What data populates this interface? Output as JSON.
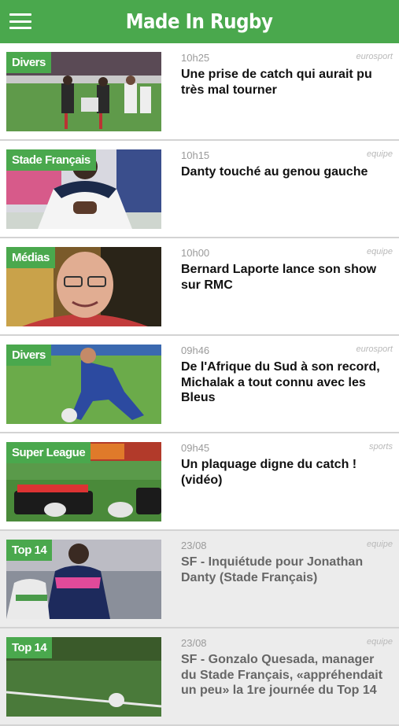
{
  "app": {
    "title": "Made In Rugby"
  },
  "articles": [
    {
      "category": "Divers",
      "time": "10h25",
      "source": "eurosport",
      "title": "Une prise de catch qui aurait pu très mal tourner"
    },
    {
      "category": "Stade Français",
      "time": "10h15",
      "source": "equipe",
      "title": "Danty touché au genou gauche"
    },
    {
      "category": "Médias",
      "time": "10h00",
      "source": "equipe",
      "title": "Bernard Laporte lance son show sur RMC"
    },
    {
      "category": "Divers",
      "time": "09h46",
      "source": "eurosport",
      "title": "De l'Afrique du Sud à son record, Michalak a tout connu avec les Bleus"
    },
    {
      "category": "Super League",
      "time": "09h45",
      "source": "sports",
      "title": "Un plaquage digne du catch ! (vidéo)"
    },
    {
      "category": "Top 14",
      "time": "23/08",
      "source": "equipe",
      "title": "SF - Inquiétude pour Jonathan Danty (Stade Français)"
    },
    {
      "category": "Top 14",
      "time": "23/08",
      "source": "equipe",
      "title": "SF - Gonzalo Quesada, manager du Stade Français, «appréhendait un peu» la 1re journée du Top 14"
    }
  ]
}
